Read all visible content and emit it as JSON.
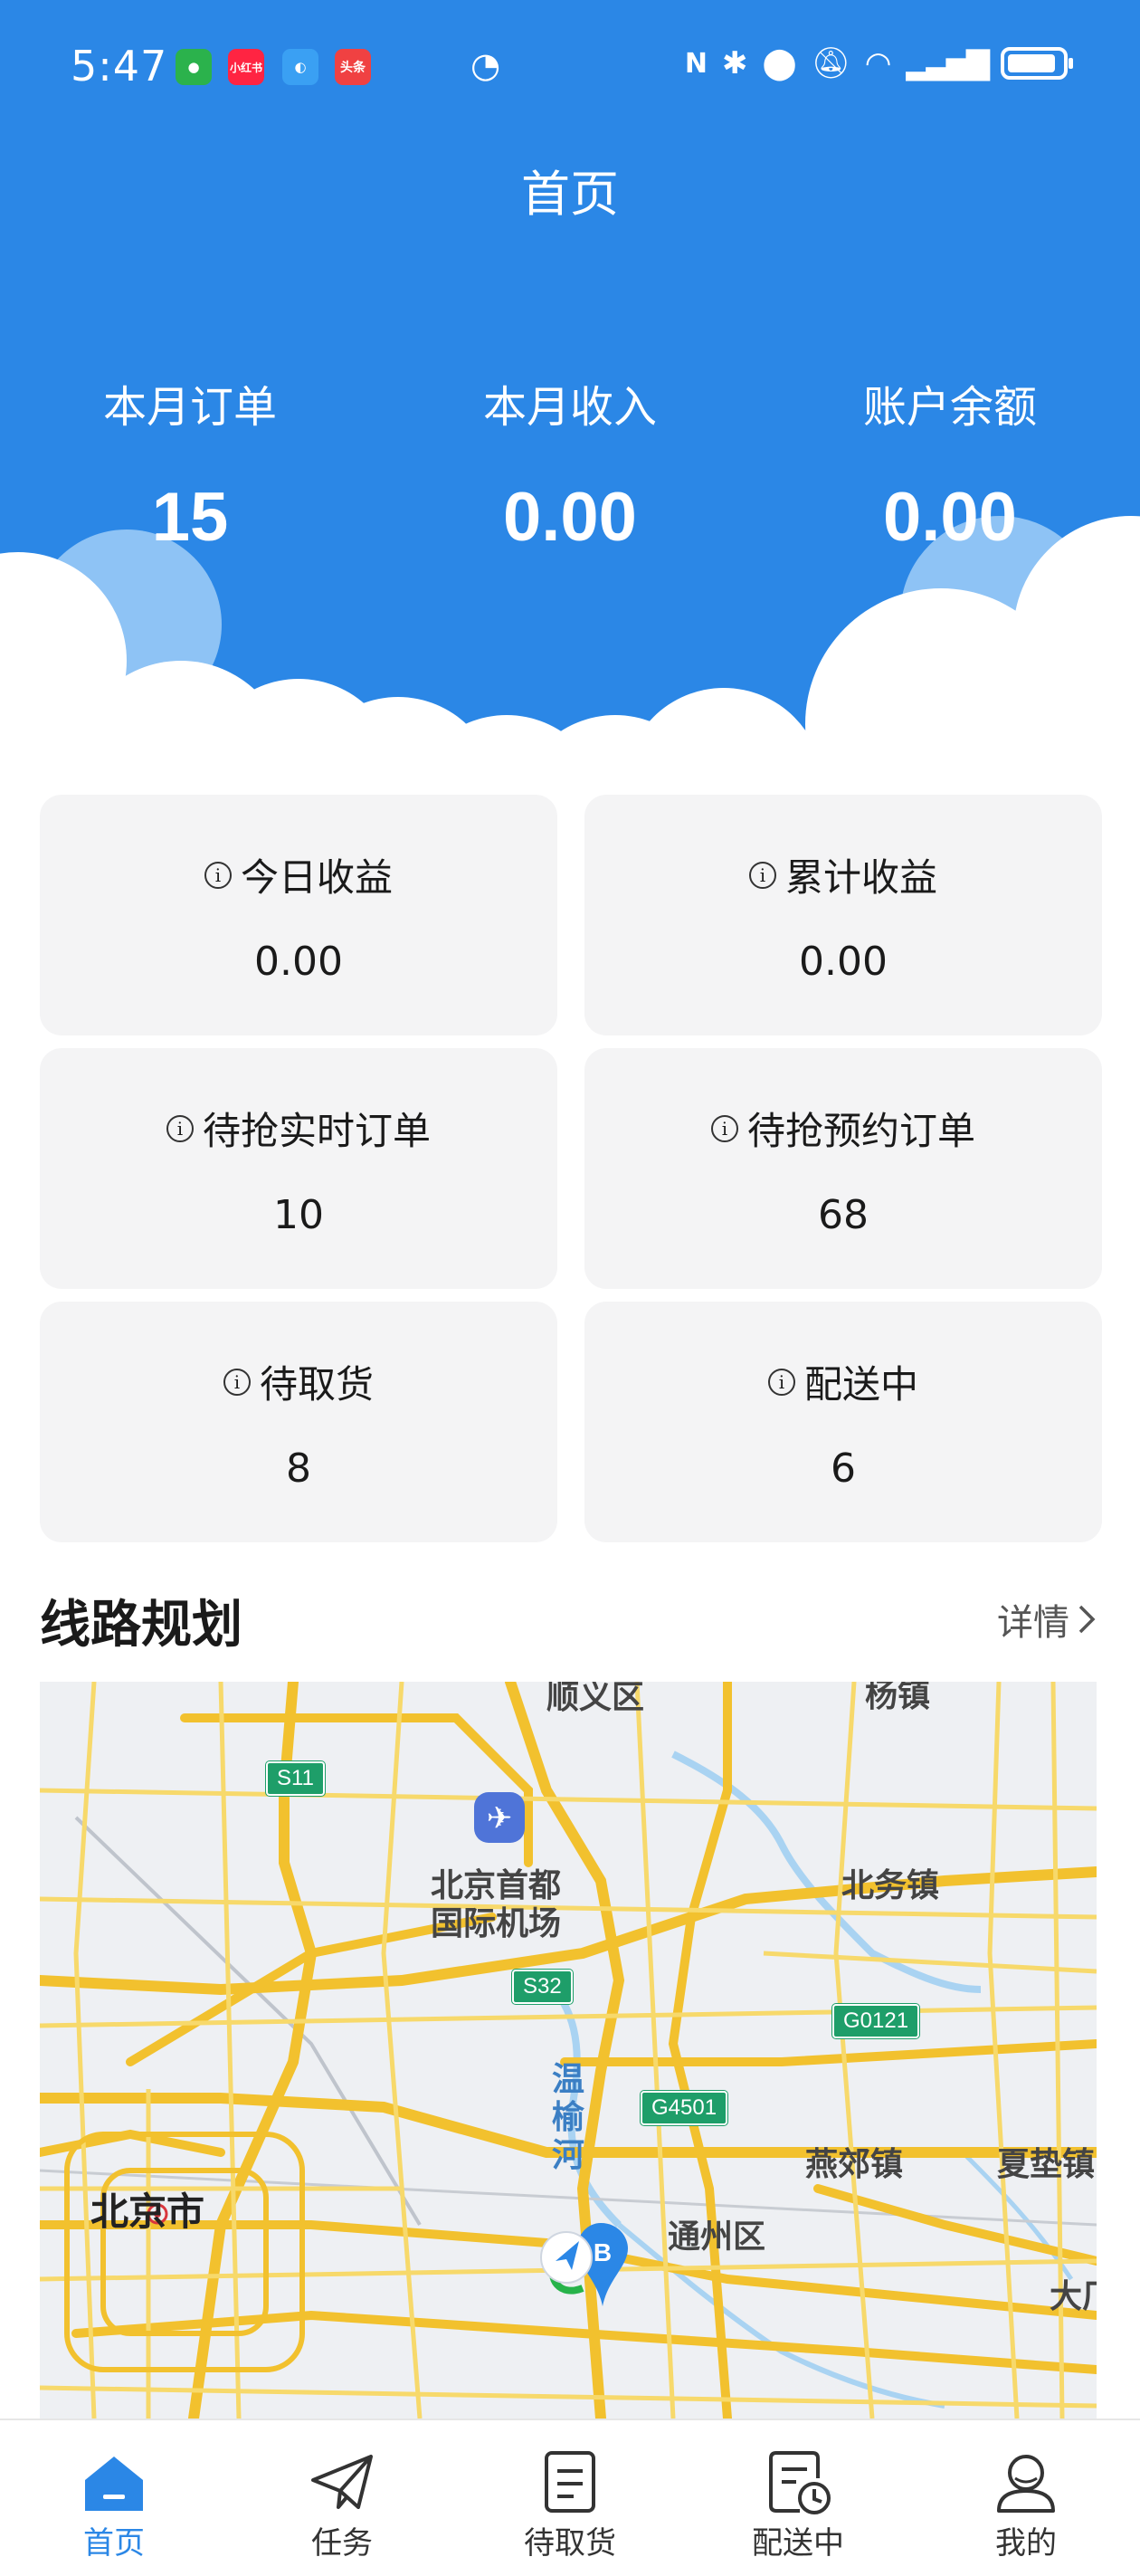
{
  "status_bar": {
    "time": "5:47",
    "apps": [
      "wechat-icon",
      "xiaohongshu-icon",
      "browser-icon",
      "toutiao-icon"
    ],
    "app_labels": {
      "xiaohongshu": "小红书",
      "toutiao": "头条"
    }
  },
  "header": {
    "title": "首页",
    "stats": [
      {
        "label": "本月订单",
        "value": "15"
      },
      {
        "label": "本月收入",
        "value": "0.00"
      },
      {
        "label": "账户余额",
        "value": "0.00"
      }
    ]
  },
  "cards": [
    {
      "label": "今日收益",
      "value": "0.00"
    },
    {
      "label": "累计收益",
      "value": "0.00"
    },
    {
      "label": "待抢实时订单",
      "value": "10"
    },
    {
      "label": "待抢预约订单",
      "value": "68"
    },
    {
      "label": "待取货",
      "value": "8"
    },
    {
      "label": "配送中",
      "value": "6"
    }
  ],
  "route": {
    "title": "线路规划",
    "detail_label": "详情",
    "map_labels": {
      "shunyi": "顺义区",
      "yang_town": "杨镇",
      "airport_line1": "北京首都",
      "airport_line2": "国际机场",
      "beiwu": "北务镇",
      "wenyu_1": "温",
      "wenyu_2": "榆",
      "wenyu_3": "河",
      "yanjiao": "燕郊镇",
      "xiadian": "夏垫镇",
      "tongzhou": "通州区",
      "beijing": "北京市",
      "dachang": "大厂"
    },
    "road_tags": {
      "s11": "S11",
      "s32": "S32",
      "g0121": "G0121",
      "g4501": "G4501"
    }
  },
  "tabbar": [
    {
      "label": "首页",
      "icon": "home-icon",
      "active": true
    },
    {
      "label": "任务",
      "icon": "paper-plane-icon",
      "active": false
    },
    {
      "label": "待取货",
      "icon": "document-icon",
      "active": false
    },
    {
      "label": "配送中",
      "icon": "clock-document-icon",
      "active": false
    },
    {
      "label": "我的",
      "icon": "user-icon",
      "active": false
    }
  ],
  "colors": {
    "primary": "#2b87e6",
    "card_bg": "#f4f4f5",
    "map_road": "#f5c842"
  }
}
